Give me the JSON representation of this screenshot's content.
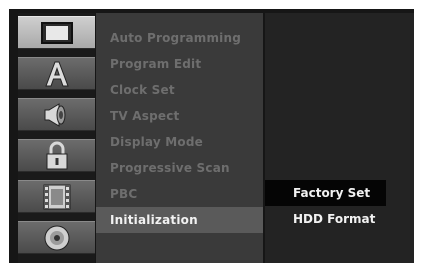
{
  "icons": [
    {
      "name": "tv-picture-icon",
      "selected": true
    },
    {
      "name": "language-a-icon",
      "selected": false
    },
    {
      "name": "speaker-audio-icon",
      "selected": false
    },
    {
      "name": "padlock-icon",
      "selected": false
    },
    {
      "name": "film-strip-icon",
      "selected": false
    },
    {
      "name": "disc-icon",
      "selected": false
    }
  ],
  "menu": {
    "items": [
      "Auto Programming",
      "Program Edit",
      "Clock Set",
      "TV Aspect",
      "Display Mode",
      "Progressive Scan",
      "PBC",
      "Initialization"
    ],
    "active_item": "Initialization"
  },
  "submenu": {
    "items": [
      "Factory Set",
      "HDD Format"
    ],
    "highlighted_item": "Factory Set"
  },
  "colors": {
    "menu_inactive_text": "#6e6e6e",
    "menu_active_text": "#f2f2f2",
    "menu_active_bg": "#5a5a5a",
    "submenu_highlight_bg": "#050505"
  }
}
